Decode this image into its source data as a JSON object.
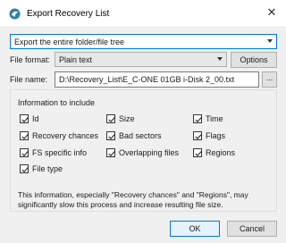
{
  "window": {
    "title": "Export Recovery List",
    "close_glyph": "✕"
  },
  "scope_select": {
    "value": "Export the entire folder/file tree"
  },
  "format": {
    "label": "File format:",
    "value": "Plain text",
    "options_label": "Options"
  },
  "filename": {
    "label": "File name:",
    "value": "D:\\Recovery_List\\E_C-ONE 01GB i-Disk 2_00.txt",
    "browse_label": "..."
  },
  "info_group": {
    "title": "Information to include",
    "options": [
      {
        "label": "Id",
        "checked": true
      },
      {
        "label": "Size",
        "checked": true
      },
      {
        "label": "Time",
        "checked": true
      },
      {
        "label": "Recovery chances",
        "checked": true
      },
      {
        "label": "Bad sectors",
        "checked": true
      },
      {
        "label": "Flags",
        "checked": true
      },
      {
        "label": "FS specific info",
        "checked": true
      },
      {
        "label": "Overlapping files",
        "checked": true
      },
      {
        "label": "Regions",
        "checked": true
      },
      {
        "label": "File type",
        "checked": true
      }
    ],
    "note_line1": "This information, especially \"Recovery chances\" and \"Regions\", may",
    "note_line2": "significantly slow this process and increase resulting file size."
  },
  "buttons": {
    "ok": "OK",
    "cancel": "Cancel"
  },
  "colors": {
    "accent": "#0078d7",
    "icon": "#3a8fb7"
  }
}
